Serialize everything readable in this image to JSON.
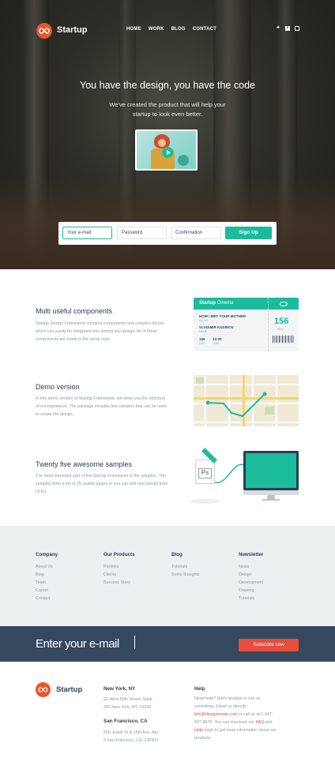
{
  "nav": {
    "brand": "Startup",
    "links": [
      "HOME",
      "WORK",
      "BLOG",
      "CONTACT"
    ]
  },
  "hero": {
    "title": "You have the design, you have the code",
    "subtitle": "We've created the product that will help your startup to look even better."
  },
  "signup": {
    "email_placeholder": "Your e-mail",
    "password_placeholder": "Password",
    "confirm_placeholder": "Confirmation",
    "button": "Sign Up"
  },
  "features": [
    {
      "title": "Multi useful components",
      "text": "Startup Design Framework contains components and complex blocks which can easily be integrated into almost any design. All of these components are made in the same style."
    },
    {
      "title": "Demo version",
      "text": "In this demo version of Startup Framework, we show you the structure of our framework. The package includes few samples that can be used to create the design."
    },
    {
      "title": "Twenty five awesome samples",
      "text": "The most important part of the Startup Framework is the samples. The samples form a set of 25 usable pages or you can add new blocks from UI Kit."
    }
  ],
  "ticket": {
    "brand": "Startup",
    "brand_suffix": "Cinema",
    "movie": "HOW I MET YOUR MOTHER",
    "movie_label": "MOVIE",
    "name": "VLADIMIR KUDINOV",
    "name_label": "NAME",
    "day": "156",
    "day_label": "DAY",
    "time": "12:00",
    "time_label": "TIME",
    "seat": "156",
    "seat_label": "SEAT"
  },
  "psd_label": "Ps",
  "footer": {
    "columns": [
      {
        "title": "Company",
        "items": [
          "About Us",
          "Blog",
          "Team",
          "Career",
          "Contact"
        ]
      },
      {
        "title": "Our Products",
        "items": [
          "Portfolio",
          "Clients",
          "Success Story"
        ]
      },
      {
        "title": "Blog",
        "items": [
          "Tutorials",
          "Some thoughts"
        ]
      },
      {
        "title": "Newsletter",
        "items": [
          "News",
          "Design",
          "Development",
          "Drawing",
          "Tutorials"
        ]
      }
    ]
  },
  "subscribe": {
    "placeholder": "Enter your e-mail",
    "button": "Subscribe now"
  },
  "bottom": {
    "brand": "Startup",
    "ny_title": "New York, NY",
    "ny_line1": "62 West 55th Street, Suite",
    "ny_line2": "302 New York, NY, 10230",
    "sf_title": "San Francisco, CA",
    "sf_line1": "560 Judah St & 15th Ave, Apt",
    "sf_line2": "5 San Francisco, CA, 230903",
    "help_title": "Help",
    "help_text1": "Need help? Don't hesitate to ask us something. Email us directly",
    "help_email": "info@designmodo.com",
    "help_text2": "or call us at 1-347-567-8670. You can checkout our",
    "help_faq": "FAQ",
    "help_and": "and",
    "help_help": "Help",
    "help_text3": "page to get more information about our products."
  },
  "colors": {
    "accent": "#1abc9c",
    "brand_orange": "#e8562a",
    "subscribe_bg": "#34495e",
    "subscribe_button": "#e74c3c"
  }
}
